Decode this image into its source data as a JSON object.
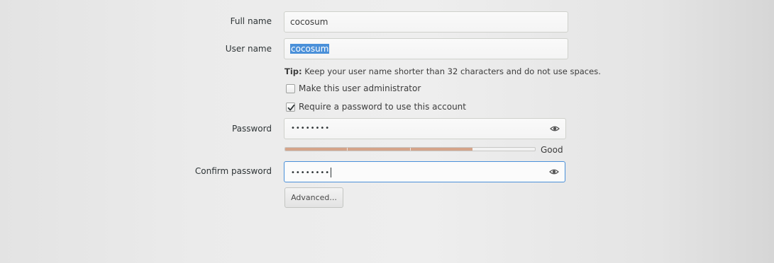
{
  "form": {
    "full_name": {
      "label": "Full name",
      "value": "cocosum"
    },
    "user_name": {
      "label": "User name",
      "value": "cocosum"
    },
    "tip": {
      "prefix": "Tip:",
      "text": " Keep your user name shorter than 32 characters and do not use spaces."
    },
    "admin_checkbox": {
      "label": "Make this user administrator",
      "checked": false
    },
    "password_checkbox": {
      "label": "Require a password to use this account",
      "checked": true
    },
    "password": {
      "label": "Password",
      "masked_value": "••••••••"
    },
    "strength": {
      "label": "Good",
      "level": 0.75
    },
    "confirm_password": {
      "label": "Confirm password",
      "masked_value": "••••••••"
    },
    "advanced_button": {
      "label": "Advanced..."
    }
  },
  "icons": {
    "reveal": "eye-icon",
    "check": "checkmark-icon"
  },
  "colors": {
    "focus": "#4a90d9",
    "selection": "#4a90d9",
    "strength_fill": "#d4a48a"
  }
}
